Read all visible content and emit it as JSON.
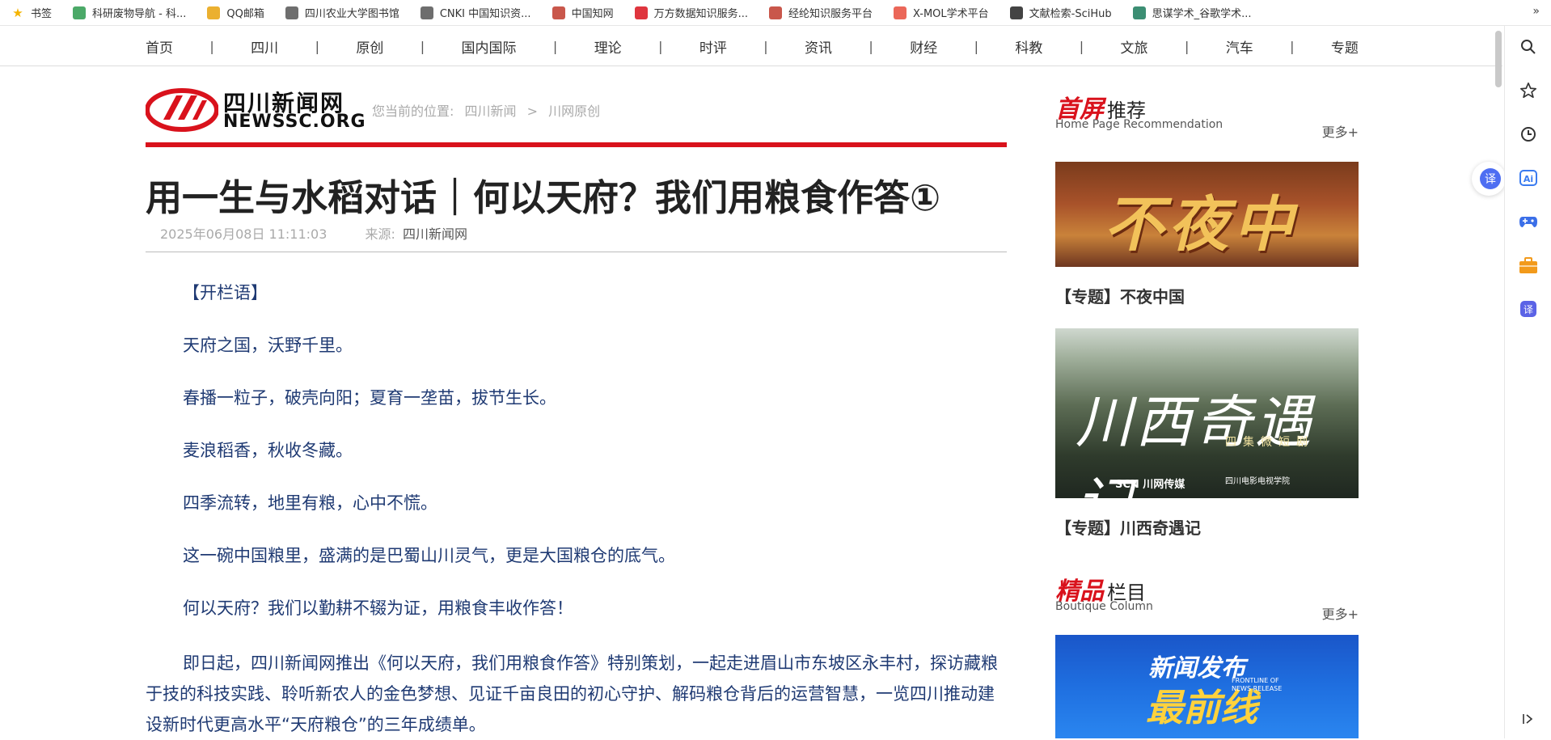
{
  "bookmarks": [
    {
      "label": "书签",
      "icon": "star-icon",
      "color": "#f5b400"
    },
    {
      "label": "科研废物导航 - 科...",
      "icon": "ky-logo-icon",
      "color": "#2b9a4d"
    },
    {
      "label": "QQ邮箱",
      "icon": "qq-mail-icon",
      "color": "#e8a20c"
    },
    {
      "label": "四川农业大学图书馆",
      "icon": "library-icon",
      "color": "#555555"
    },
    {
      "label": "CNKI 中国知识资...",
      "icon": "cnki-icon",
      "color": "#555555"
    },
    {
      "label": "中国知网",
      "icon": "zhiwang-icon",
      "color": "#c0392b"
    },
    {
      "label": "万方数据知识服务...",
      "icon": "wanfang-icon",
      "color": "#d9121c"
    },
    {
      "label": "经纶知识服务平台",
      "icon": "jinglun-icon",
      "color": "#c0392b"
    },
    {
      "label": "X-MOL学术平台",
      "icon": "xmol-icon",
      "color": "#e74c3c"
    },
    {
      "label": "文献检索-SciHub",
      "icon": "scihub-icon",
      "color": "#222222"
    },
    {
      "label": "思谋学术_谷歌学术...",
      "icon": "simou-icon",
      "color": "#1a7a5a"
    }
  ],
  "bookmarks_more": "»",
  "nav": [
    "首页",
    "四川",
    "原创",
    "国内国际",
    "理论",
    "时评",
    "资讯",
    "财经",
    "科教",
    "文旅",
    "汽车",
    "专题"
  ],
  "nav_sep": "|",
  "logo": {
    "cn": "四川新闻网",
    "en": "NEWSSC.ORG"
  },
  "breadcrumb": {
    "prefix": "您当前的位置:",
    "items": [
      "四川新闻",
      "川网原创"
    ],
    "sep": ">"
  },
  "article": {
    "title": "用一生与水稻对话｜何以天府？我们用粮食作答①",
    "date": "2025年06月08日 11:11:03",
    "source_label": "来源:",
    "source": "四川新闻网",
    "paragraphs": [
      "【开栏语】",
      "天府之国，沃野千里。",
      "春播一粒子，破壳向阳；夏育一垄苗，拔节生长。",
      "麦浪稻香，秋收冬藏。",
      "四季流转，地里有粮，心中不慌。",
      "这一碗中国粮里，盛满的是巴蜀山川灵气，更是大国粮仓的底气。",
      "何以天府？我们以勤耕不辍为证，用粮食丰收作答！",
      "即日起，四川新闻网推出《何以天府，我们用粮食作答》特别策划，一起走进眉山市东坡区永丰村，探访藏粮于技的科技实践、聆听新农人的金色梦想、见证千亩良田的初心守护、解码粮仓背后的运营智慧，一览四川推动建设新时代更高水平“天府粮仓”的三年成绩单。"
    ]
  },
  "sidebar": {
    "recommend": {
      "big": "首屏",
      "small": "推荐",
      "en": "Home Page Recommendation",
      "more": "更多+"
    },
    "cards": [
      {
        "img_text": "不夜中国",
        "caption": "【专题】不夜中国"
      },
      {
        "img_text": "川西奇遇记",
        "img_sub": "四集微短剧",
        "brand1": "SCN 川网传媒",
        "brand2": "四川电影电视学院",
        "caption": "【专题】川西奇遇记"
      }
    ],
    "boutique": {
      "big": "精品",
      "small": "栏目",
      "en": "Boutique Column",
      "more": "更多+"
    },
    "boutique_card": {
      "t1": "新闻发布",
      "t2": "最前线",
      "t3": "FRONTLINE OF NEWS RELEASE"
    }
  },
  "browser_sidebar": {
    "icons": [
      "search-icon",
      "star-outline-icon",
      "history-icon",
      "ai-icon",
      "game-icon",
      "toolbox-icon",
      "translate-icon",
      "collapse-icon"
    ],
    "translate_float": "译",
    "ai_label": "Ai",
    "translate_label": "译"
  },
  "colors": {
    "accent": "#d9121c",
    "body_text": "#1f3a73",
    "meta": "#aaaaaa"
  }
}
